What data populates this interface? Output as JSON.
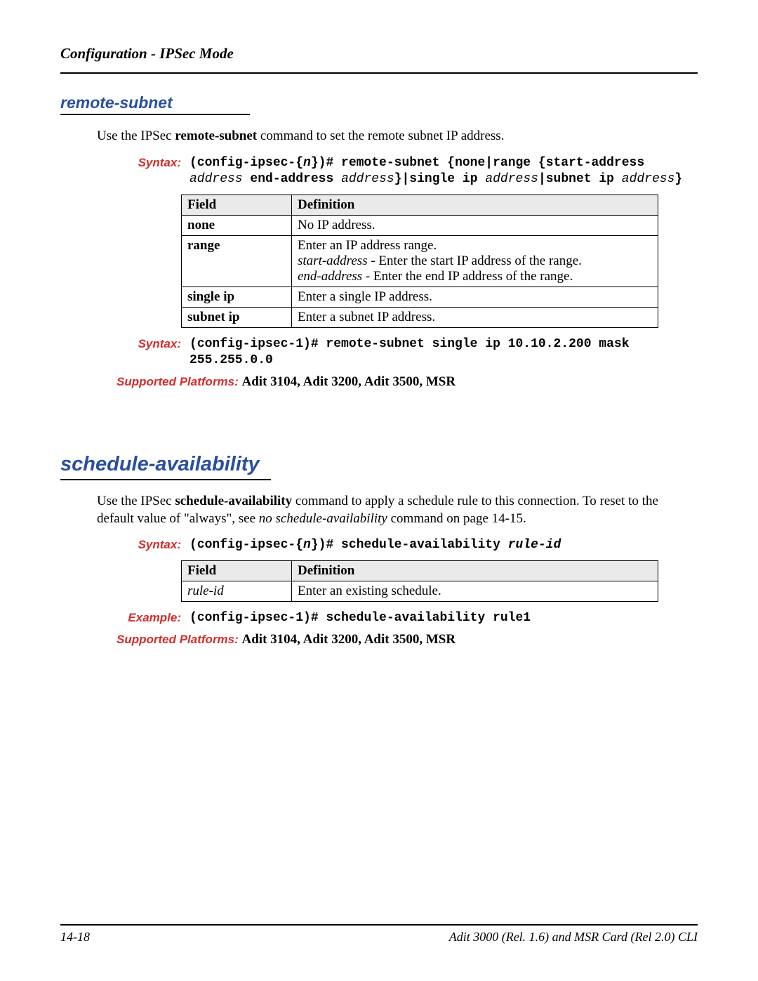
{
  "running_head": "Configuration - IPSec Mode",
  "section1": {
    "title": "remote-subnet",
    "intro_prefix": "Use the IPSec ",
    "intro_bold": "remote-subnet",
    "intro_suffix": " command to set the remote subnet IP address.",
    "syntax_label": "Syntax:",
    "syntax_parts": {
      "p1b": "(config-ipsec-{",
      "p2i": "n",
      "p3b": "})# remote-subnet {none|range {start-address ",
      "p4i": "address",
      "p5b": " end-address ",
      "p6i": "address",
      "p7b": "}|single ip ",
      "p8i": "address",
      "p9b": "|subnet ip ",
      "p10i": "address",
      "p11b": "}"
    },
    "table": {
      "h_field": "Field",
      "h_def": "Definition",
      "rows": [
        {
          "field": "none",
          "def": "No IP address."
        },
        {
          "field": "range",
          "def_l1": "Enter an IP address range.",
          "def_l2a": "start-address",
          "def_l2b": " - Enter the start IP address of the range.",
          "def_l3a": "end-address",
          "def_l3b": " - Enter the end IP address of the range."
        },
        {
          "field": "single ip",
          "def": "Enter a single IP address."
        },
        {
          "field": "subnet ip",
          "def": "Enter a subnet IP address."
        }
      ]
    },
    "example_label": "Syntax:",
    "example_text": "(config-ipsec-1)# remote-subnet single ip 10.10.2.200 mask 255.255.0.0",
    "platforms_label": "Supported Platforms:  ",
    "platforms_text": "Adit 3104, Adit 3200, Adit 3500, MSR"
  },
  "section2": {
    "title": "schedule-availability",
    "intro_prefix": "Use the IPSec ",
    "intro_bold1": "schedule-availability",
    "intro_mid": " command to apply a schedule rule to this connection. To reset to the default value of \"always\", see ",
    "intro_ital": "no schedule-availability",
    "intro_suffix": " command on page 14-15.",
    "syntax_label": "Syntax:",
    "syntax_parts": {
      "p1b": "(config-ipsec-{",
      "p2i": "n",
      "p3b": "})# schedule-availability ",
      "p4i": "rule-id"
    },
    "table": {
      "h_field": "Field",
      "h_def": "Definition",
      "rows": [
        {
          "field_it": "rule-id",
          "def": "Enter an existing schedule."
        }
      ]
    },
    "example_label": "Example:",
    "example_text": "(config-ipsec-1)# schedule-availability rule1",
    "platforms_label": "Supported Platforms:  ",
    "platforms_text": "Adit 3104, Adit 3200, Adit 3500, MSR"
  },
  "footer": {
    "page_no": "14-18",
    "doc": "Adit 3000 (Rel. 1.6) and MSR Card (Rel 2.0) CLI"
  }
}
